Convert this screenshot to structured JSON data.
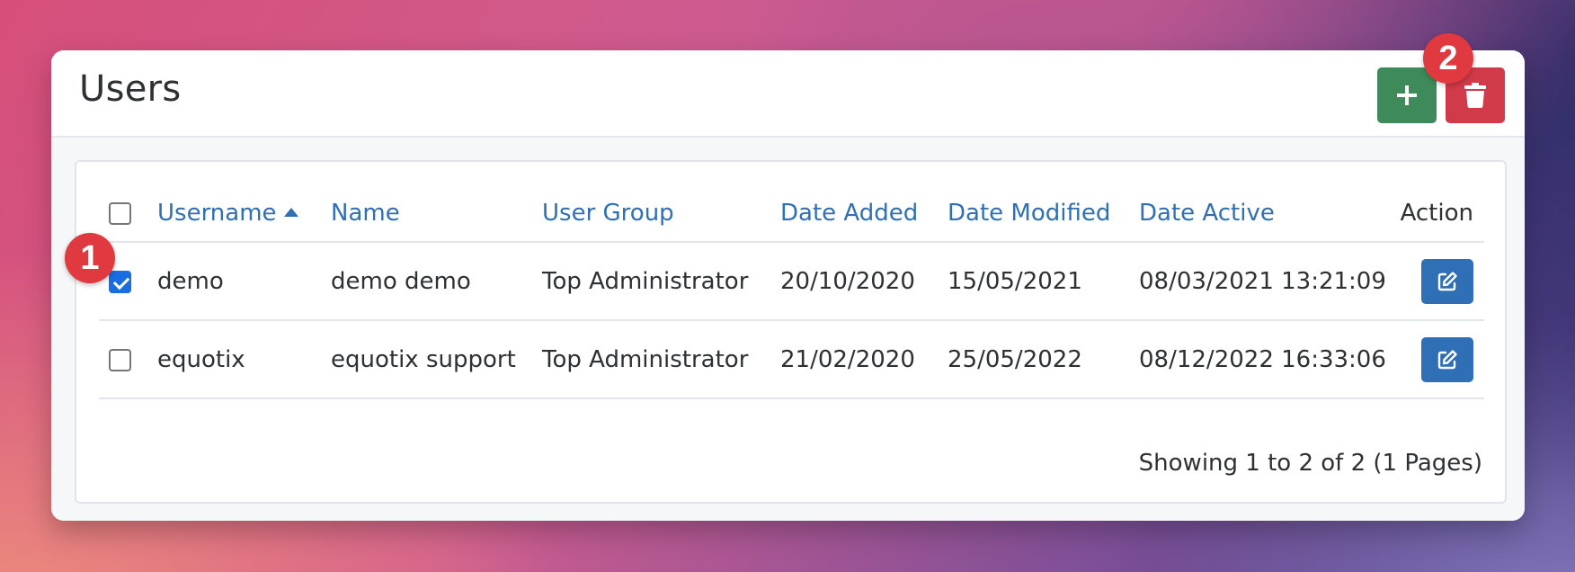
{
  "header": {
    "title": "Users",
    "add_icon": "plus-icon",
    "delete_icon": "trash-icon"
  },
  "table": {
    "columns": [
      "Username",
      "Name",
      "User Group",
      "Date Added",
      "Date Modified",
      "Date Active",
      "Action"
    ],
    "sorted_column": "Username",
    "sort_direction": "ascending",
    "rows": [
      {
        "checked": true,
        "username": "demo",
        "name": "demo demo",
        "user_group": "Top Administrator",
        "date_added": "20/10/2020",
        "date_modified": "15/05/2021",
        "date_active": "08/03/2021 13:21:09"
      },
      {
        "checked": false,
        "username": "equotix",
        "name": "equotix support",
        "user_group": "Top Administrator",
        "date_added": "21/02/2020",
        "date_modified": "25/05/2022",
        "date_active": "08/12/2022 16:33:06"
      }
    ]
  },
  "pagination": {
    "summary": "Showing 1 to 2 of 2 (1 Pages)"
  },
  "annotations": {
    "badge_1": "1",
    "badge_2": "2"
  },
  "colors": {
    "link_blue": "#2f6fb5",
    "add_green": "#3f8a5a",
    "delete_red": "#d03a49",
    "badge_red": "#e0393f"
  }
}
